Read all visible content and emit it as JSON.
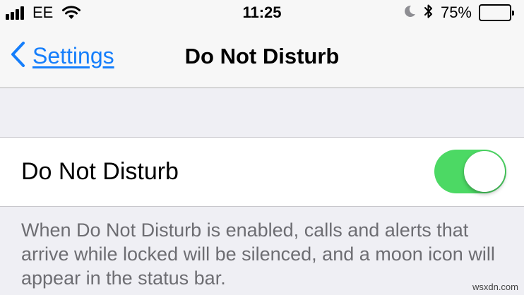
{
  "status_bar": {
    "carrier": "EE",
    "time": "11:25",
    "battery_percent": "75%",
    "battery_level": 0.75,
    "signal_bars": 4,
    "icons": [
      "signal-icon",
      "wifi-icon",
      "moon-icon",
      "bluetooth-icon",
      "battery-icon"
    ]
  },
  "nav": {
    "back_label": "Settings",
    "title": "Do Not Disturb"
  },
  "setting": {
    "label": "Do Not Disturb",
    "enabled": true,
    "toggle_on_color": "#4cd964"
  },
  "footer_text": "When Do Not Disturb is enabled, calls and alerts that arrive while locked will be silenced, and a moon icon will appear in the status bar.",
  "watermark": "wsxdn.com",
  "colors": {
    "accent": "#157efb",
    "background": "#efeff4",
    "footer_text": "#6d6d72"
  }
}
